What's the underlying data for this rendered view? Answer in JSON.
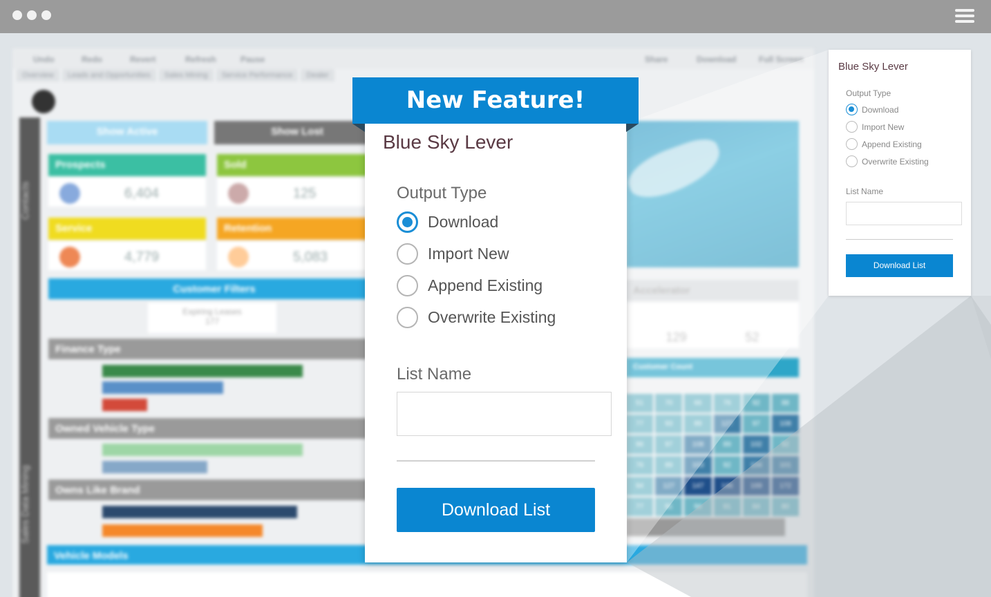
{
  "feature_banner": "New Feature!",
  "panel": {
    "title": "Blue Sky Lever",
    "output_type_label": "Output Type",
    "options": [
      "Download",
      "Import New",
      "Append Existing",
      "Overwrite Existing"
    ],
    "selected_option": "Download",
    "list_name_label": "List Name",
    "list_name_value": "",
    "button_label": "Download List"
  },
  "background": {
    "toolbar": [
      "Undo",
      "Redo",
      "Revert",
      "Refresh",
      "Pause",
      "Share",
      "Download",
      "Full Screen"
    ],
    "tabs": [
      "Overview",
      "Leads and Opportunities",
      "Sales Mining",
      "Service Performance",
      "Dealer"
    ],
    "sidebar": [
      "Contacts",
      "Sales Data Mining"
    ],
    "buttons": [
      "Show Active",
      "Show Lost"
    ],
    "cards": [
      {
        "label": "Prospects",
        "value": "6,404",
        "color": "#3bbfa3"
      },
      {
        "label": "Sold",
        "value": "125",
        "color": "#8dc63f"
      },
      {
        "label": "Service",
        "value": "4,779",
        "color": "#f0dc20"
      },
      {
        "label": "Retention",
        "value": "5,083",
        "color": "#f5a623"
      }
    ],
    "customer_filters": "Customer Filters",
    "expiring_leases": "Expiring Leases",
    "expiring_leases_value": "177",
    "finance_type": "Finance Type",
    "owned_vehicle_type": "Owned Vehicle Type",
    "owns_like_brand": "Owns Like Brand",
    "vehicle_models": "Vehicle Models",
    "accelerator": "Accelerator",
    "customer_count": "Customer Count",
    "accel_values": [
      "129",
      "52"
    ],
    "grid_values": [
      [
        "51",
        "70",
        "66",
        "76",
        "92",
        "88"
      ],
      [
        "77",
        "93",
        "89",
        "127",
        "97",
        "108"
      ],
      [
        "96",
        "97",
        "108",
        "89",
        "102",
        "92"
      ],
      [
        "76",
        "89",
        "103",
        "92",
        "104",
        "101"
      ],
      [
        "94",
        "127",
        "147",
        "146",
        "169",
        "172"
      ],
      [
        "77",
        "91",
        "94",
        "91",
        "84",
        "80"
      ]
    ]
  }
}
